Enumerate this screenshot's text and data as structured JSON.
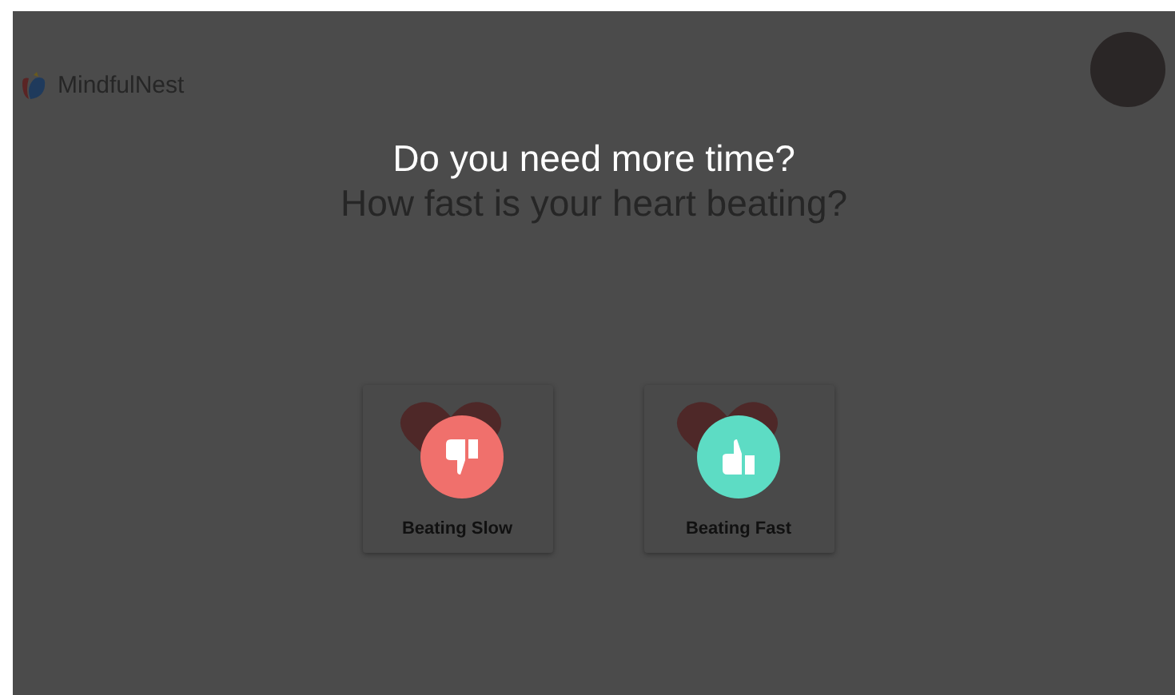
{
  "header": {
    "brand": "MindfulNest"
  },
  "prompt": {
    "title": "Do you need more time?",
    "question": "How fast is your heart beating?"
  },
  "options": [
    {
      "label": "Beating Slow",
      "kind": "slow"
    },
    {
      "label": "Beating Fast",
      "kind": "fast"
    }
  ]
}
